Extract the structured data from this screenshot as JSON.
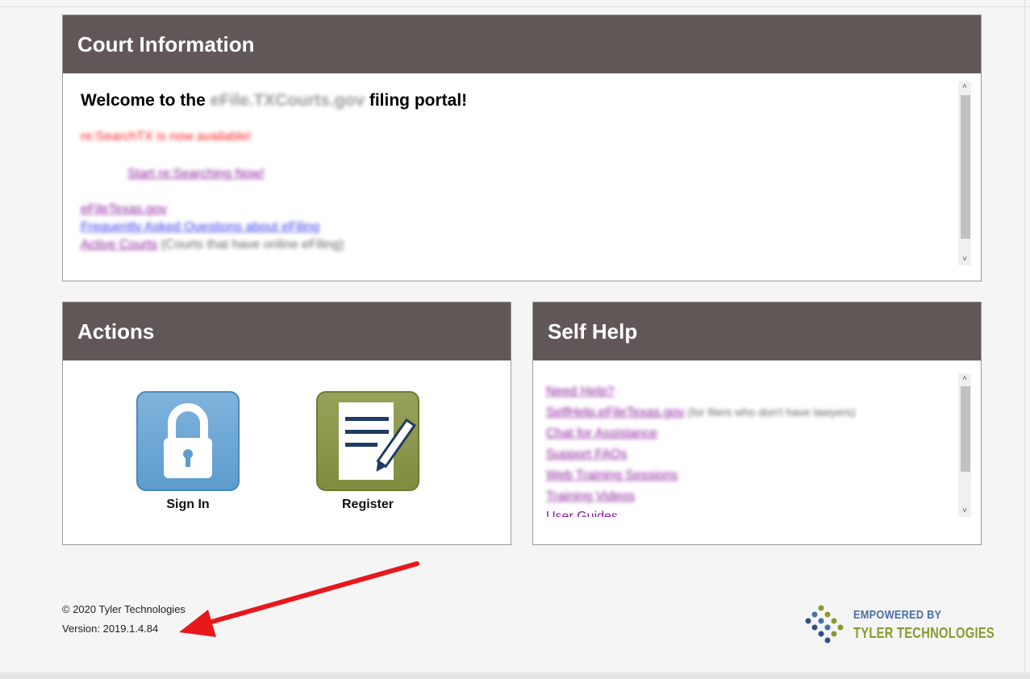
{
  "court_info": {
    "title": "Court Information",
    "welcome_prefix": "Welcome to the ",
    "welcome_site": "eFile.TXCourts.gov",
    "welcome_suffix": " filing portal!",
    "announcement": "re:SearchTX is now available!",
    "start_link": "Start re:Searching Now!",
    "links": [
      {
        "text": "eFileTexas.gov"
      },
      {
        "text": "Frequently Asked Questions about eFiling"
      },
      {
        "text": "Active Courts",
        "note": " (Courts that have online eFiling)"
      }
    ]
  },
  "actions": {
    "title": "Actions",
    "sign_in_label": "Sign In",
    "register_label": "Register"
  },
  "self_help": {
    "title": "Self Help",
    "links": [
      {
        "text": "Need Help?"
      },
      {
        "text": "SelfHelp.eFileTexas.gov",
        "note": " (for filers who don't have lawyers)"
      },
      {
        "text": "Chat for Assistance"
      },
      {
        "text": "Support FAQs"
      },
      {
        "text": "Web Training Sessions"
      },
      {
        "text": "Training Videos"
      },
      {
        "text": "User Guides"
      }
    ]
  },
  "footer": {
    "copyright": "© 2020 Tyler Technologies",
    "version": "Version: 2019.1.4.84",
    "logo_line1": "EMPOWERED BY",
    "logo_line2": "TYLER TECHNOLOGIES"
  },
  "colors": {
    "header_bg": "#625757",
    "annotation_arrow": "#e8171b",
    "link_purple": "#8b1f9b",
    "link_blue": "#3a3aee"
  }
}
